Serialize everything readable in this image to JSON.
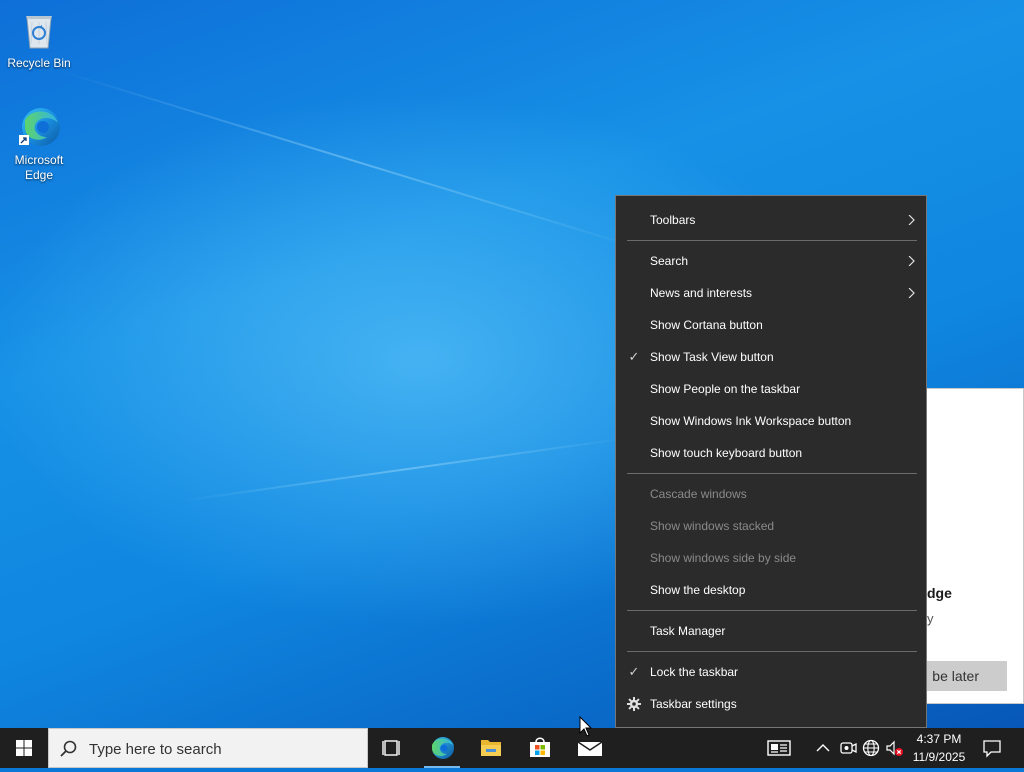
{
  "desktop": {
    "icons": [
      {
        "label": "Recycle Bin",
        "icon": "recycle-bin-icon"
      },
      {
        "label": "Microsoft Edge",
        "icon": "edge-icon"
      }
    ]
  },
  "popup": {
    "title_fragment": "dge",
    "body_fragment": "y",
    "button_fragment": "be later"
  },
  "context_menu": {
    "items": [
      {
        "label": "Toolbars",
        "submenu": true
      },
      {
        "label": "Search",
        "submenu": true
      },
      {
        "label": "News and interests",
        "submenu": true
      },
      {
        "label": "Show Cortana button"
      },
      {
        "label": "Show Task View button",
        "checked": true
      },
      {
        "label": "Show People on the taskbar"
      },
      {
        "label": "Show Windows Ink Workspace button"
      },
      {
        "label": "Show touch keyboard button"
      },
      {
        "label": "Cascade windows",
        "disabled": true
      },
      {
        "label": "Show windows stacked",
        "disabled": true
      },
      {
        "label": "Show windows side by side",
        "disabled": true
      },
      {
        "label": "Show the desktop"
      },
      {
        "label": "Task Manager"
      },
      {
        "label": "Lock the taskbar",
        "checked": true
      },
      {
        "label": "Taskbar settings",
        "icon": "gear-icon"
      }
    ]
  },
  "taskbar": {
    "search_placeholder": "Type here to search",
    "pinned": [
      "task-view-icon",
      "edge-icon",
      "file-explorer-icon",
      "store-icon",
      "mail-icon"
    ],
    "tray": [
      "news-icon",
      "chevron-up-icon",
      "meet-now-icon",
      "network-icon",
      "volume-muted-icon"
    ],
    "time": "4:37 PM",
    "date": "11/9/2025",
    "accent": "#76b9ed"
  }
}
